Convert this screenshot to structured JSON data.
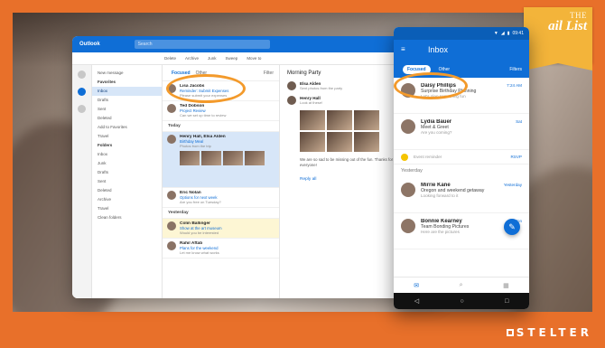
{
  "tag": {
    "line1": "THE",
    "line2": "ail List"
  },
  "brand": {
    "name": "STELTER"
  },
  "colors": {
    "frame": "#e8702a",
    "accent": "#0f6ed6",
    "highlight": "#f39a2b",
    "tag": "#f3b43a"
  },
  "desktop": {
    "app_name": "Outlook",
    "search_placeholder": "Search",
    "toolbar": [
      "Delete",
      "Archive",
      "Junk",
      "Sweep",
      "Move to"
    ],
    "folders": [
      {
        "label": "New message",
        "cls": ""
      },
      {
        "label": "Favorites",
        "cls": "hdr"
      },
      {
        "label": "Inbox",
        "cls": "sel"
      },
      {
        "label": "Drafts",
        "cls": ""
      },
      {
        "label": "Sent",
        "cls": ""
      },
      {
        "label": "Deleted",
        "cls": ""
      },
      {
        "label": "Add to Favorites",
        "cls": ""
      },
      {
        "label": "Travel",
        "cls": ""
      },
      {
        "label": "Folders",
        "cls": "hdr"
      },
      {
        "label": "Inbox",
        "cls": ""
      },
      {
        "label": "Junk",
        "cls": ""
      },
      {
        "label": "Drafts",
        "cls": ""
      },
      {
        "label": "Sent",
        "cls": ""
      },
      {
        "label": "Deleted",
        "cls": ""
      },
      {
        "label": "Archive",
        "cls": ""
      },
      {
        "label": "Travel",
        "cls": ""
      },
      {
        "label": "Clean folders",
        "cls": ""
      }
    ],
    "tabs": {
      "focused": "Focused",
      "other": "Other",
      "filter": "Filter"
    },
    "messages_top": [
      {
        "name": "Lisa Jacobs",
        "subject": "Reminder: Submit Expenses",
        "preview": "Please submit your expenses"
      },
      {
        "name": "Ted Dobson",
        "subject": "Project Review",
        "preview": "Can we set up time to review"
      }
    ],
    "group_today": "Today",
    "message_highlight": {
      "name": "Henry Hall, Elsa Alden",
      "subject": "Birthday Meal",
      "preview": "Photos from the trip"
    },
    "messages_mid": [
      {
        "name": "Eric Nolan",
        "subject": "Options for next week",
        "preview": "Are you free on Tuesday?"
      }
    ],
    "group_yesterday": "Yesterday",
    "messages_bottom": [
      {
        "name": "Colin Ballinger",
        "subject": "Show at the art museum",
        "preview": "Would you be interested",
        "cls": "yel"
      },
      {
        "name": "Rahil Aftab",
        "subject": "Plans for the weekend",
        "preview": "Let me know what works",
        "cls": ""
      }
    ],
    "reading": {
      "heading": "Morning Party",
      "sender1": {
        "name": "Elsa Alden",
        "preview": "Sent photos from the party"
      },
      "sender2": {
        "name": "Henry Hall",
        "preview": "Look at these!"
      },
      "note": "We are so sad to be missing out of the fun. Thanks for coming out everyone!",
      "reply": "Reply all"
    }
  },
  "phone": {
    "status": [
      "▼",
      "◢",
      "▮",
      "09:41"
    ],
    "menu_icon": "≡",
    "title": "Inbox",
    "tabs": {
      "focused": "Focused",
      "other": "Other"
    },
    "filter": "Filters",
    "messages": [
      {
        "name": "Daisy Phillips",
        "subject": "Surprise Birthday Planning",
        "preview": "Let's plan something fun",
        "time": "7:24 AM"
      },
      {
        "name": "Lydia Bauer",
        "subject": "Meet & Greet",
        "preview": "Are you coming?",
        "time": "Sat"
      }
    ],
    "calendar": {
      "text": "Event reminder",
      "action": "RSVP"
    },
    "section": "Yesterday",
    "messages2": [
      {
        "name": "Mirrie Kane",
        "subject": "Oregon and weekend getaway",
        "preview": "Looking forward to it",
        "time": "Yesterday"
      },
      {
        "name": "Bonnie Kearney",
        "subject": "Team Bonding Pictures",
        "preview": "Here are the pictures",
        "time": "Mon"
      }
    ],
    "fab": "✎",
    "bottom_icons": [
      "✉",
      "⌕",
      "▦"
    ],
    "nav_icons": [
      "◁",
      "○",
      "□"
    ]
  }
}
